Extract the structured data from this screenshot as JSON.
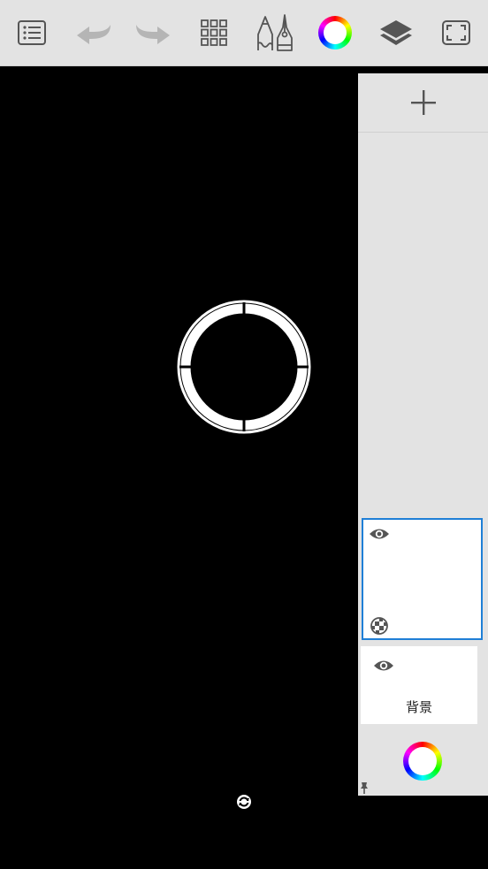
{
  "toolbar": {
    "items": [
      {
        "name": "menu-list",
        "icon": "list-icon"
      },
      {
        "name": "undo",
        "icon": "undo-arrow-icon"
      },
      {
        "name": "redo",
        "icon": "redo-arrow-icon"
      },
      {
        "name": "tool-grid",
        "icon": "grid-icon"
      },
      {
        "name": "brush-tools",
        "icon": "pencil-pen-icon"
      },
      {
        "name": "color-picker",
        "icon": "color-wheel-icon"
      },
      {
        "name": "layers",
        "icon": "layers-icon"
      },
      {
        "name": "fullscreen",
        "icon": "fullscreen-icon"
      }
    ]
  },
  "layers_panel": {
    "add_icon": "plus-icon",
    "layers": [
      {
        "name": "",
        "visible": true,
        "selected": true
      },
      {
        "name": "背景",
        "visible": true,
        "selected": false
      }
    ],
    "color_icon": "color-wheel-icon",
    "pin_icon": "pin-icon"
  },
  "colors": {
    "toolbar_bg": "#e3e3e3",
    "canvas_bg": "#000000",
    "selection_border": "#1f7fd6",
    "icon_gray": "#555555",
    "disabled_gray": "#b5b5b5"
  }
}
